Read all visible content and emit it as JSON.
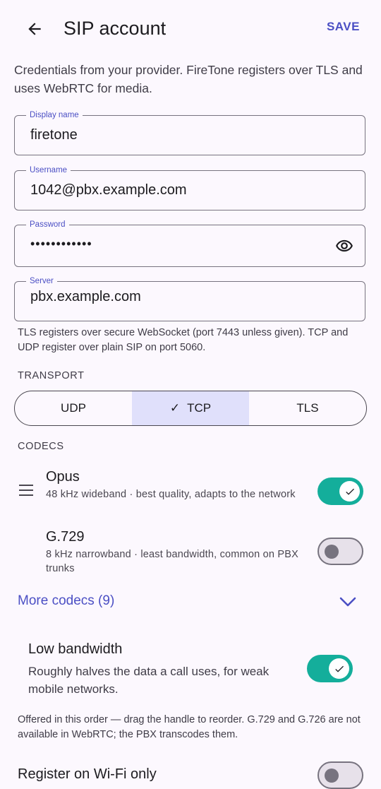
{
  "header": {
    "title": "SIP account",
    "save_label": "SAVE"
  },
  "intro": "Credentials from your provider. FireTone registers over TLS and uses WebRTC for media.",
  "fields": {
    "display_name": {
      "label": "Display name",
      "value": "firetone"
    },
    "username": {
      "label": "Username",
      "value": "1042@pbx.example.com"
    },
    "password": {
      "label": "Password",
      "value": "••••••••••••"
    },
    "server": {
      "label": "Server",
      "value": "pbx.example.com"
    }
  },
  "server_helper": "TLS registers over secure WebSocket (port 7443 unless given). TCP and UDP register over plain SIP on port 5060.",
  "transport": {
    "heading": "TRANSPORT",
    "options": [
      "UDP",
      "TCP",
      "TLS"
    ],
    "selected": "TCP"
  },
  "codecs": {
    "heading": "CODECS",
    "items": [
      {
        "name": "Opus",
        "description": "48 kHz wideband · best quality, adapts to the network",
        "enabled": true
      },
      {
        "name": "G.729",
        "description": "8 kHz narrowband · least bandwidth, common on PBX trunks",
        "enabled": false
      }
    ],
    "more_label": "More codecs (9)"
  },
  "low_bandwidth": {
    "title": "Low bandwidth",
    "description": "Roughly halves the data a call uses, for weak mobile networks.",
    "enabled": true
  },
  "codec_note": "Offered in this order — drag the handle to reorder. G.729 and G.726 are not available in WebRTC; the PBX transcodes them.",
  "wifi_only": {
    "title": "Register on Wi-Fi only",
    "enabled": false
  },
  "colors": {
    "accent": "#4b4fc4",
    "switch_on": "#14ae9b",
    "segment_selected": "#e0e0fb",
    "background": "#fcf8fe"
  }
}
